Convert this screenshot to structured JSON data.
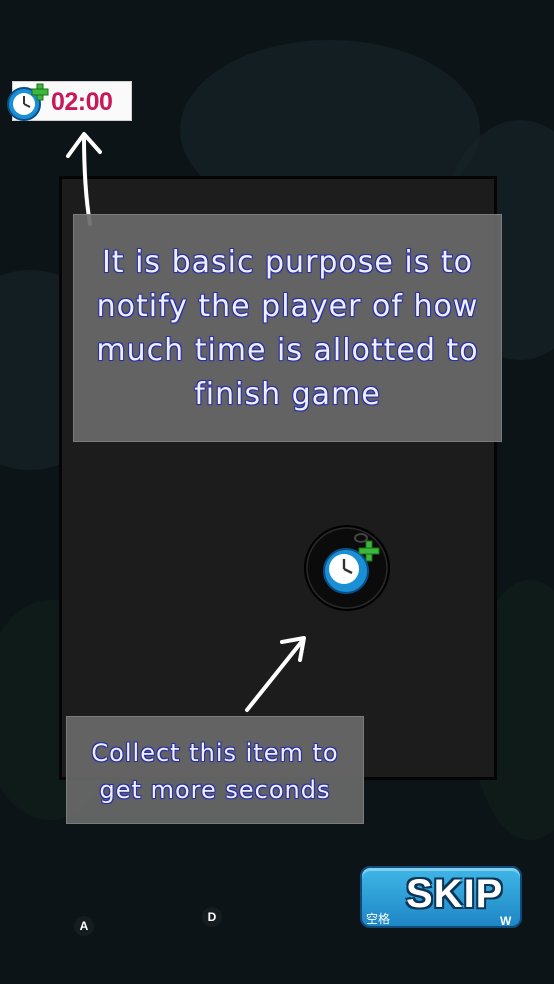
{
  "hud": {
    "timer_value": "02:00",
    "timer_icon": "stopwatch-plus-icon"
  },
  "tips": {
    "timer_tip": "It is basic purpose is to notify the player of how much time is allotted to finish game",
    "item_tip": "Collect this item to get more seconds"
  },
  "pickup": {
    "icon": "stopwatch-plus-icon"
  },
  "skip_button": {
    "label": "SKIP",
    "hotkey_primary": "空格",
    "hotkey_secondary": "W"
  },
  "controls": {
    "left_key": "A",
    "right_key": "D"
  },
  "colors": {
    "timer_text": "#c8185a",
    "skip_button": "#2a9ed8",
    "tip_text_outline": "#2b2fa8"
  }
}
